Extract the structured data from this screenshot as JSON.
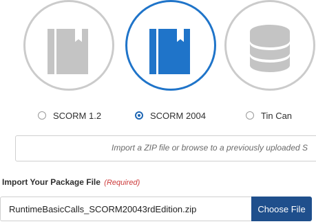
{
  "package_types": [
    {
      "label": "SCORM 1.2",
      "icon": "book-icon",
      "selected": false
    },
    {
      "label": "SCORM 2004",
      "icon": "book-icon",
      "selected": true
    },
    {
      "label": "Tin Can",
      "icon": "database-icon",
      "selected": false
    }
  ],
  "colors": {
    "accent": "#1f74c9",
    "icon_inactive": "#c4c4c4",
    "button_bg": "#1f4f8c",
    "required": "#cc3a3a"
  },
  "drop_zone": {
    "text": "Import a ZIP file or browse to a previously uploaded S"
  },
  "import": {
    "label": "Import Your Package File",
    "required": "(Required)",
    "file_name": "RuntimeBasicCalls_SCORM20043rdEdition.zip",
    "button_label": "Choose File"
  }
}
